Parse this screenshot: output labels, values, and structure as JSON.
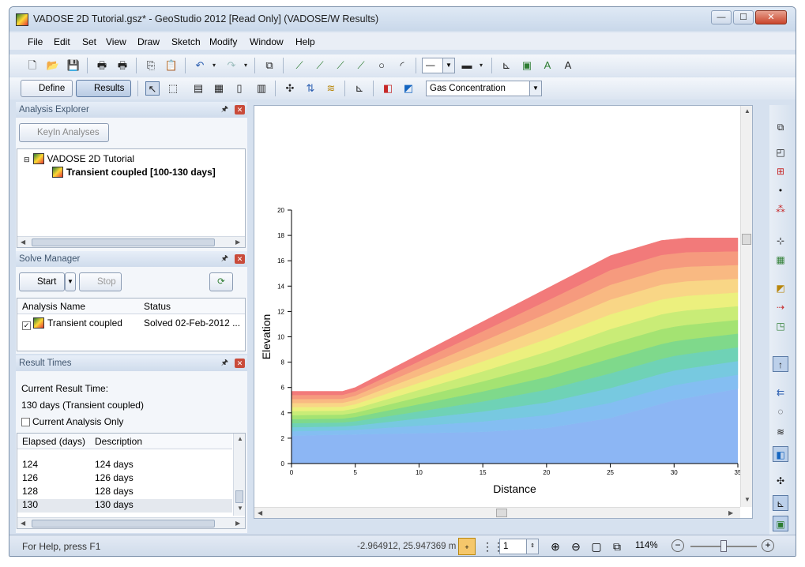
{
  "window": {
    "title": "VADOSE 2D Tutorial.gsz* - GeoStudio 2012 [Read Only] (VADOSE/W Results)",
    "minimize": "—",
    "maximize": "☐",
    "close": "✕"
  },
  "menu": [
    "File",
    "Edit",
    "Set",
    "View",
    "Draw",
    "Sketch",
    "Modify",
    "Window",
    "Help"
  ],
  "toolbar2": {
    "define_label": "Define",
    "results_label": "Results",
    "result_type": "Gas Concentration"
  },
  "analysis_explorer": {
    "title": "Analysis Explorer",
    "keyin_label": "KeyIn Analyses",
    "root": "VADOSE 2D Tutorial",
    "child": "Transient coupled [100-130 days]"
  },
  "solve_manager": {
    "title": "Solve Manager",
    "start_label": "Start",
    "stop_label": "Stop",
    "col_name": "Analysis Name",
    "col_status": "Status",
    "row_name": "Transient coupled",
    "row_status": "Solved 02-Feb-2012 ..."
  },
  "result_times": {
    "title": "Result Times",
    "current_label": "Current Result Time:",
    "current_value": "130 days (Transient coupled)",
    "current_only_label": "Current Analysis Only",
    "col_elapsed": "Elapsed (days)",
    "col_desc": "Description",
    "rows": [
      {
        "elapsed": "124",
        "desc": "124 days"
      },
      {
        "elapsed": "126",
        "desc": "126 days"
      },
      {
        "elapsed": "128",
        "desc": "128 days"
      },
      {
        "elapsed": "130",
        "desc": "130 days"
      }
    ]
  },
  "status": {
    "help": "For Help, press F1",
    "coords": "-2.964912, 25.947369 m",
    "grid_spacing": "1",
    "zoom": "114%"
  },
  "colors": {
    "accent": "#5b7ba6",
    "band_colors": [
      "#f27a7a",
      "#f69a7e",
      "#f9b982",
      "#f9d686",
      "#ecf07e",
      "#c9ec77",
      "#a4e372",
      "#7fd98b",
      "#6fd2b6",
      "#77c9e0",
      "#84bef2",
      "#8cb6f4"
    ]
  },
  "chart_data": {
    "type": "area",
    "title": "",
    "xlabel": "Distance",
    "ylabel": "Elevation",
    "xlim": [
      0,
      35
    ],
    "ylim": [
      0,
      20
    ],
    "x_ticks": [
      "0",
      "5",
      "10",
      "15",
      "20",
      "25",
      "30",
      "35"
    ],
    "y_ticks": [
      "0",
      "2",
      "4",
      "6",
      "8",
      "10",
      "12",
      "14",
      "16",
      "18",
      "20"
    ],
    "surface": {
      "x": [
        0,
        4,
        5,
        10,
        15,
        20,
        25,
        29,
        31,
        35
      ],
      "y": [
        5.7,
        5.7,
        6.0,
        8.6,
        11.2,
        13.8,
        16.4,
        17.6,
        17.8,
        17.8
      ]
    },
    "base": {
      "x": [
        0,
        5,
        10,
        15,
        20,
        25,
        30,
        35
      ],
      "y": [
        2.2,
        2.3,
        2.4,
        2.5,
        2.8,
        3.6,
        5.0,
        5.9
      ]
    }
  }
}
